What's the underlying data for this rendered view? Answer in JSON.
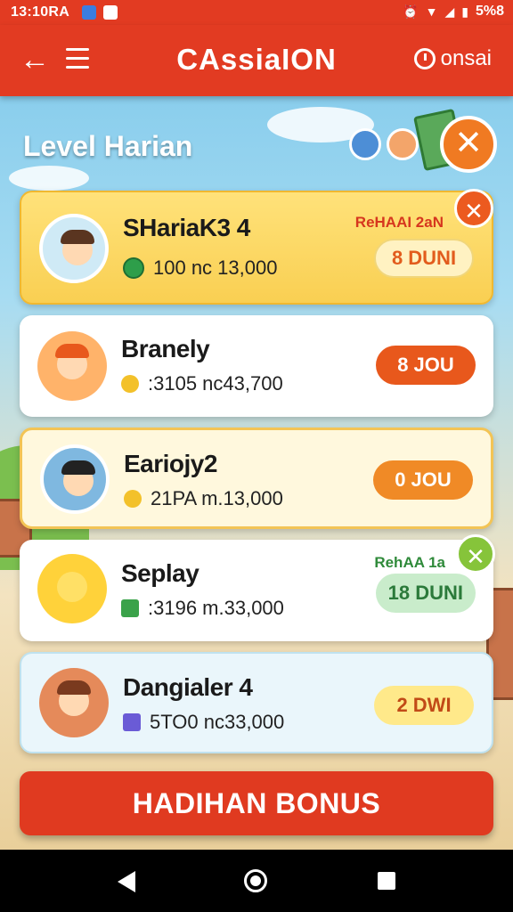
{
  "status_bar": {
    "time": "13:10RA",
    "right_text": "5%8"
  },
  "app_bar": {
    "title": "CAssiaION",
    "account_label": "onsai"
  },
  "heading": "Level Harian",
  "cards": [
    {
      "name": "SHariaK3 4",
      "detail": "100 nc 13,000",
      "tag": "ReHAAI 2aN",
      "reward": "8 DUNI",
      "accent": "#f9cf52"
    },
    {
      "name": "Branely",
      "detail": ":3105 nc43,700",
      "reward": "8 JOU",
      "accent": "#e8581c"
    },
    {
      "name": "Eariojy2",
      "detail": "21PA m.13,000",
      "reward": "0 JOU",
      "accent": "#f08a26"
    },
    {
      "name": "Seplay",
      "detail": ":3196 m.33,000",
      "tag": "RehAA 1a",
      "reward": "18 DUNI",
      "accent": "#c9eccb"
    },
    {
      "name": "Dangialer 4",
      "detail": "5TO0 nc33,000",
      "reward": "2 DWI",
      "accent": "#ffe98a"
    }
  ],
  "bonus_button": "HADIHAN BONUS",
  "icons": [
    "back-arrow-icon",
    "menu-icon",
    "clock-icon",
    "close-icon",
    "coin-icon",
    "home-nav-icon",
    "back-nav-icon",
    "recent-nav-icon"
  ]
}
